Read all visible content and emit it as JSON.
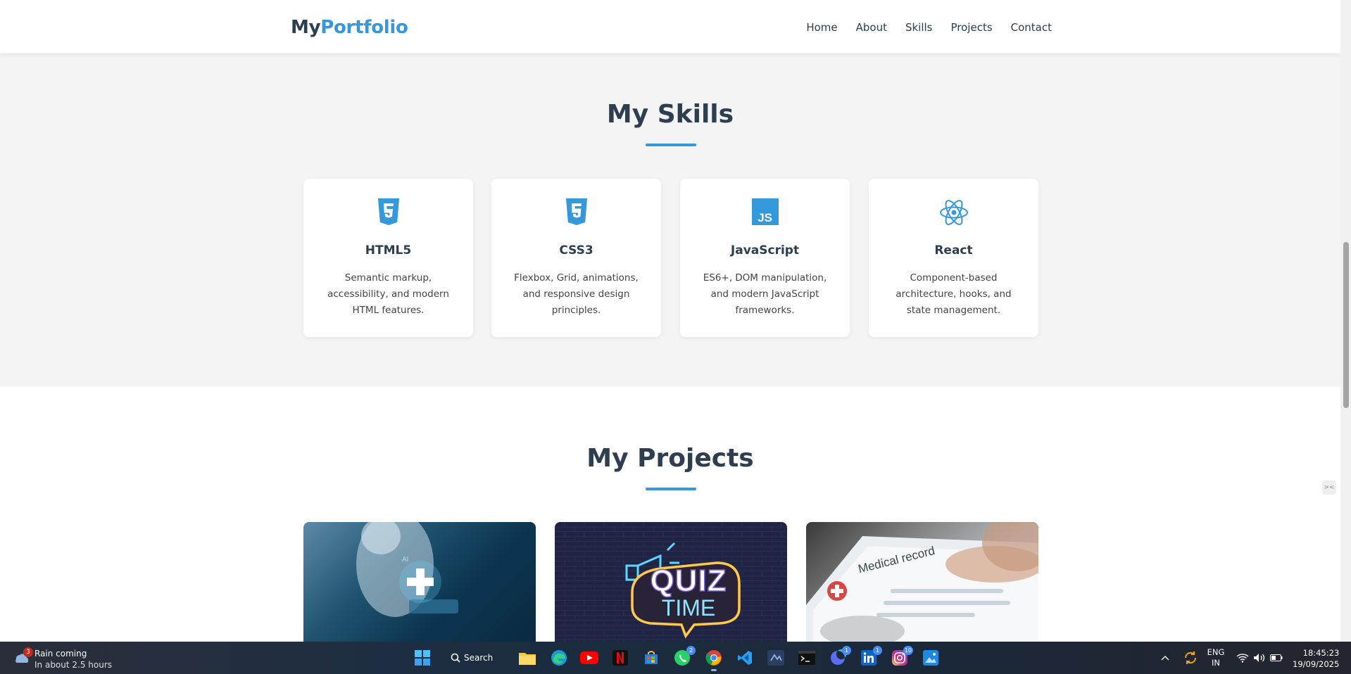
{
  "navbar": {
    "logo_part1": "My",
    "logo_part2": "Portfolio",
    "links": [
      "Home",
      "About",
      "Skills",
      "Projects",
      "Contact"
    ]
  },
  "skills": {
    "title": "My Skills",
    "cards": [
      {
        "icon": "html5-icon",
        "title": "HTML5",
        "desc": "Semantic markup, accessibility, and modern HTML features."
      },
      {
        "icon": "css3-icon",
        "title": "CSS3",
        "desc": "Flexbox, Grid, animations, and responsive design principles."
      },
      {
        "icon": "javascript-icon",
        "title": "JavaScript",
        "desc": "ES6+, DOM manipulation, and modern JavaScript frameworks."
      },
      {
        "icon": "react-icon",
        "title": "React",
        "desc": "Component-based architecture, hooks, and state management."
      }
    ]
  },
  "projects": {
    "title": "My Projects",
    "cards": [
      {
        "image": "doctor-ai-medical-image"
      },
      {
        "image": "quiz-time-neon-image",
        "text_line1": "QUIZ",
        "text_line2": "TIME"
      },
      {
        "image": "medical-record-tablet-image",
        "text": "Medical record"
      }
    ]
  },
  "taskbar": {
    "weather_badge": "3",
    "weather_line1": "Rain coming",
    "weather_line2": "In about 2.5 hours",
    "search_label": "Search",
    "apps": [
      {
        "name": "start-button"
      },
      {
        "name": "file-explorer-icon"
      },
      {
        "name": "edge-icon"
      },
      {
        "name": "youtube-icon"
      },
      {
        "name": "netflix-icon"
      },
      {
        "name": "microsoft-store-icon"
      },
      {
        "name": "whatsapp-icon",
        "badge": "2"
      },
      {
        "name": "chrome-icon"
      },
      {
        "name": "vscode-icon"
      },
      {
        "name": "code-editor-icon"
      },
      {
        "name": "terminal-icon"
      },
      {
        "name": "copilot-icon",
        "badge": "1"
      },
      {
        "name": "linkedin-icon",
        "badge": "1"
      },
      {
        "name": "instagram-icon",
        "badge": "10"
      },
      {
        "name": "photos-icon"
      }
    ],
    "lang_line1": "ENG",
    "lang_line2": "IN",
    "time": "18:45:23",
    "date": "19/09/2025"
  },
  "colors": {
    "accent": "#3498db",
    "heading": "#2c3e50",
    "section_bg": "#f4f4f4"
  }
}
